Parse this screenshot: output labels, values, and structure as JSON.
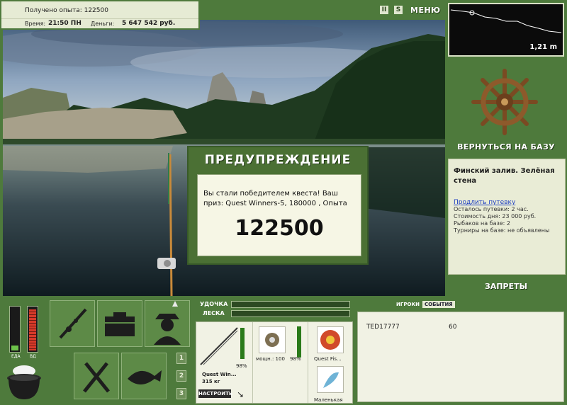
{
  "stats": {
    "exp_label": "Получено опыта: 122500",
    "time_label": "Время:",
    "time_value": "21:50 ПН",
    "money_label": "Деньги:",
    "money_value": "5 647 542 руб."
  },
  "top_icons": {
    "pause": "II",
    "sound": "S",
    "menu": "МЕНЮ"
  },
  "depth": {
    "value": "1,21 m"
  },
  "right_panel": {
    "return_label": "ВЕРНУТЬСЯ НА БАЗУ",
    "base_name": "Финский залив. Зелёная стена",
    "extend_link": "Продлить путевку",
    "trip_left": "Осталось путевки: 2 час.",
    "day_cost": "Стоимость дня: 23 000 руб.",
    "anglers": "Рыбаков на базе: 2",
    "tournaments": "Турниры на базе: не объявлены",
    "bans_label": "ЗАПРЕТЫ"
  },
  "dialog": {
    "title": "ПРЕДУПРЕЖДЕНИЕ",
    "message": "Вы стали победителем квеста! Ваш приз: Quest Winners-5, 180000 , Опыта",
    "amount": "122500"
  },
  "status_bars": {
    "food_label": "ЕДА",
    "ad_label": "ВД",
    "food_level": 0.12,
    "ad_level": 0.96
  },
  "hotbar": {
    "buttons": [
      "1",
      "2",
      "3"
    ],
    "active": 0
  },
  "tackle": {
    "rod_label": "УДОЧКА",
    "line_label": "ЛЕСКА",
    "rod_name": "Quest Win...",
    "rod_weight": "315 кг",
    "rod_percent": "98%",
    "reel_label": "мощн.: 100",
    "reel_percent": "98%",
    "line_name": "Quest Fis...",
    "lure_name": "Маленькая",
    "adjust_label": "НАСТРОИТЬ"
  },
  "events": {
    "tabs": [
      "ИГРОКИ",
      "СОБЫТИЯ"
    ],
    "active_tab": 1,
    "rows": [
      {
        "name": "TED17777",
        "score": "60"
      }
    ]
  },
  "colors": {
    "panel_green": "#4e7a3c",
    "dialog_green": "#4b7034",
    "cream": "#e9ecd6"
  }
}
